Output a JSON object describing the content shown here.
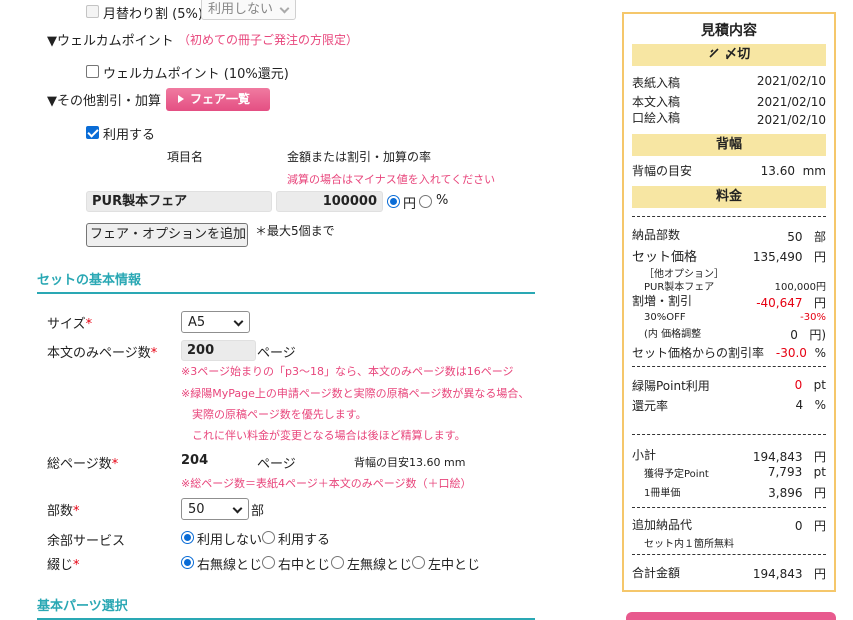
{
  "monthly_discount": {
    "label": "月替わり割 (5%)",
    "select_value": "利用しない"
  },
  "welcome": {
    "heading": "▼ウェルカムポイント",
    "note": "（初めての冊子ご発注の方限定）",
    "checkbox_label": "ウェルカムポイント (10%還元)"
  },
  "other": {
    "heading": "▼その他割引・加算",
    "fair_button": "フェア一覧",
    "use_label": "利用する",
    "col_item": "項目名",
    "col_amount": "金額または割引・加算の率",
    "minus_note": "減算の場合はマイナス値を入れてください",
    "item_name": "PUR製本フェア",
    "amount": "100000",
    "unit_yen": "円",
    "unit_pct": "%",
    "add_button": "フェア・オプションを追加",
    "max_note": "＊最大5個まで"
  },
  "basic": {
    "title": "セットの基本情報",
    "size_label": "サイズ",
    "required_mark": "*",
    "size_value": "A5",
    "body_pages_label": "本文のみページ数",
    "body_pages_value": "200",
    "pages_unit": "ページ",
    "note1": "※3ページ始まりの「p3～18」なら、本文のみページ数は16ページ",
    "note2": "※緑陽MyPage上の申請ページ数と実際の原稿ページ数が異なる場合、",
    "note3": "実際の原稿ページ数を優先します。",
    "note4": "これに伴い料金が変更となる場合は後ほど精算します。",
    "total_pages_label": "総ページ数",
    "total_pages_value": "204",
    "spine_note": "背幅の目安13.60 mm",
    "total_note": "※総ページ数＝表紙4ページ＋本文のみページ数（＋口絵）",
    "copies_label": "部数",
    "copies_value": "50",
    "copies_unit": "部",
    "extra_label": "余部サービス",
    "extra_options": [
      "利用しない",
      "利用する"
    ],
    "binding_label": "綴じ",
    "binding_options": [
      "右無線とじ",
      "右中とじ",
      "左無線とじ",
      "左中とじ"
    ]
  },
  "parts": {
    "title": "基本パーツ選択"
  },
  "estimate": {
    "title": "見積内容",
    "deadline_head": "〆切",
    "cover_label": "表紙入稿",
    "cover_date": "2021/02/10",
    "body_label": "本文入稿",
    "body_date": "2021/02/10",
    "frontis_label": "口絵入稿",
    "frontis_date": "2021/02/10",
    "spine_head": "背幅",
    "spine_label": "背幅の目安",
    "spine_value": "13.60",
    "spine_unit": "mm",
    "fee_head": "料金",
    "copies_label": "納品部数",
    "copies_value": "50",
    "copies_unit": "部",
    "set_price_label": "セット価格",
    "set_price_value": "135,490",
    "yen": "円",
    "other_opt_label": "［他オプション］",
    "pur_label": "PUR製本フェア",
    "pur_value": "100,000円",
    "discount_label": "割増・割引",
    "discount_value": "-40,647",
    "off_label": "30%OFF",
    "off_value": "-30%",
    "adjust_label": "(内 価格調整",
    "adjust_value": "0",
    "adjust_unit": "円)",
    "rate_label": "セット価格からの割引率",
    "rate_value": "-30.0",
    "rate_unit": "%",
    "point_use_label": "緑陽Point利用",
    "point_use_value": "0",
    "pt": "pt",
    "return_label": "還元率",
    "return_value": "4",
    "return_unit": "%",
    "subtotal_label": "小計",
    "subtotal_value": "194,843",
    "earn_label": "獲得予定Point",
    "earn_value": "7,793",
    "unit_price_label": "1冊単価",
    "unit_price_value": "3,896",
    "extra_fee_label": "追加納品代",
    "extra_fee_value": "0",
    "extra_fee_note": "セット内１箇所無料",
    "total_label": "合計金額",
    "total_value": "194,843"
  }
}
